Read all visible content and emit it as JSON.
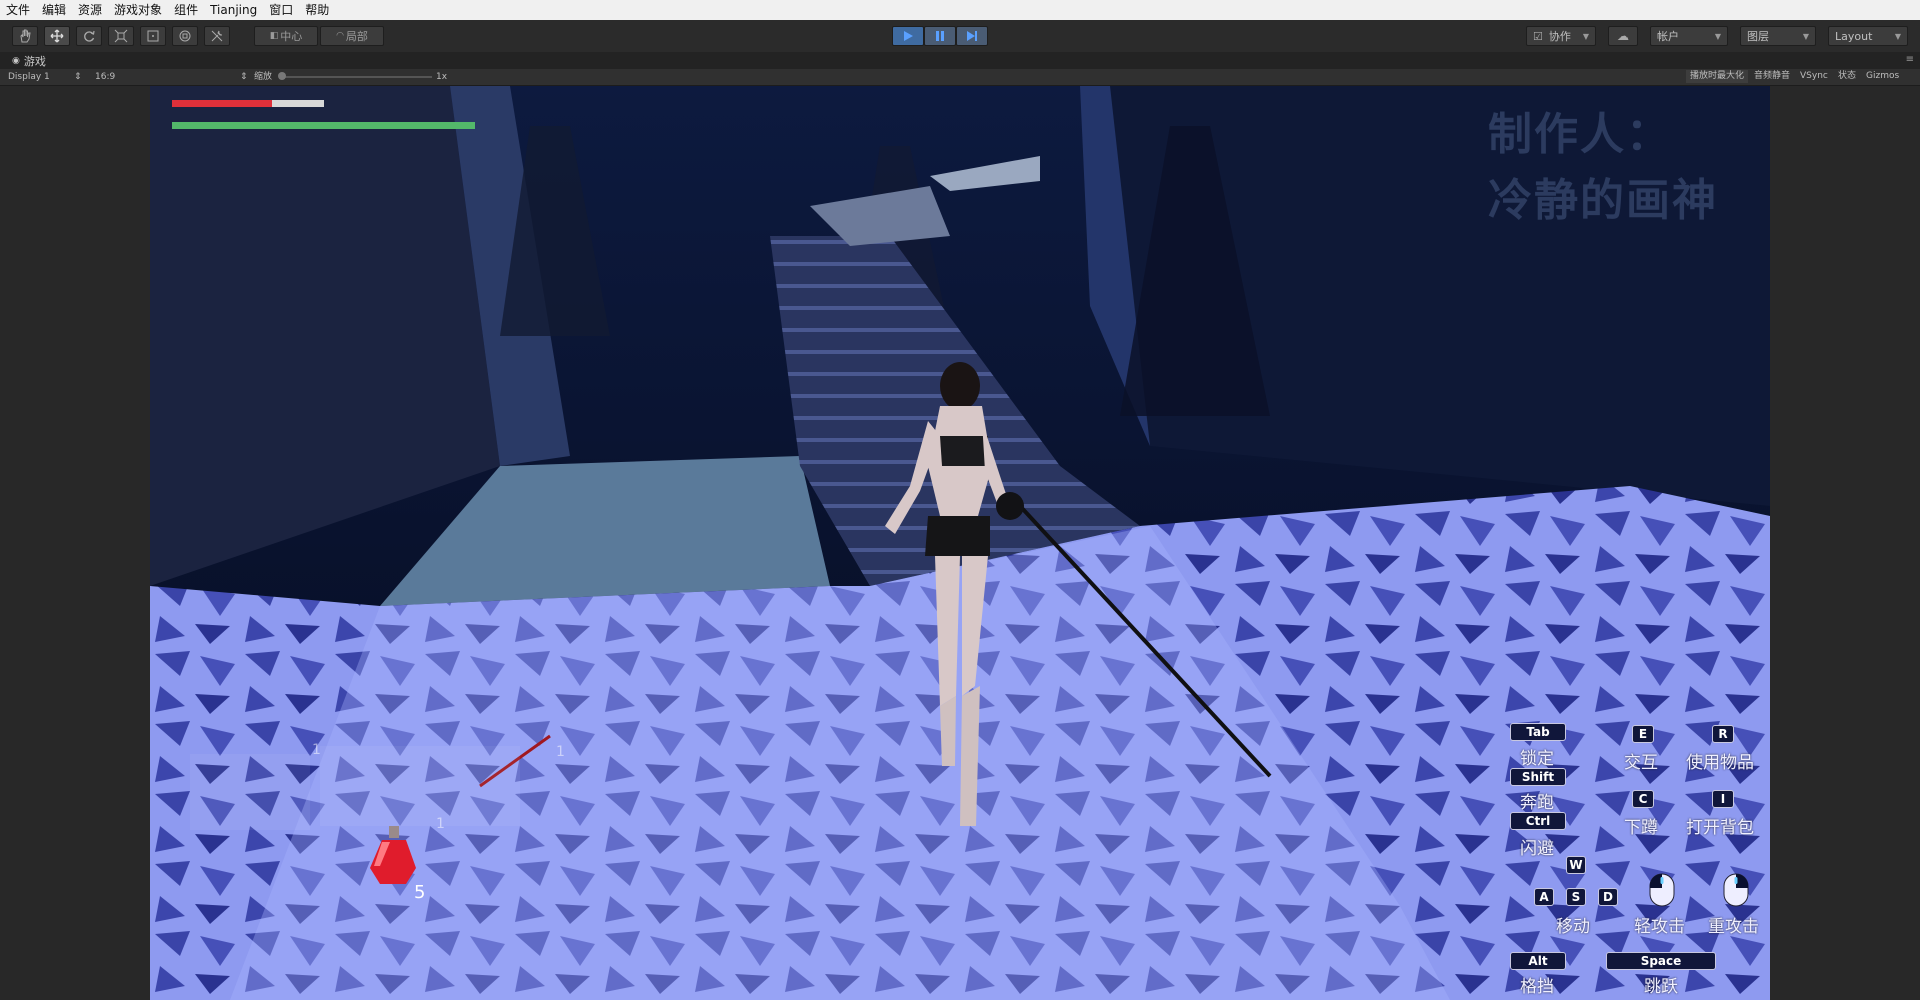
{
  "menu": [
    "文件",
    "编辑",
    "资源",
    "游戏对象",
    "组件",
    "Tianjing",
    "窗口",
    "帮助"
  ],
  "toolbar": {
    "pivot_label": "中心",
    "space_label": "局部",
    "collab_label": "协作",
    "account_label": "帐户",
    "layers_label": "图层",
    "layout_label": "Layout"
  },
  "tab": {
    "label": "游戏"
  },
  "gamebar": {
    "display": "Display 1",
    "aspect": "16:9",
    "scale_label": "缩放",
    "scale_value": "1x",
    "maximize": "播放时最大化",
    "mute": "音频静音",
    "vsync": "VSync",
    "stats": "状态",
    "gizmos": "Gizmos"
  },
  "hud": {
    "health": 0.66,
    "stamina": 1.0,
    "credit_line1": "制作人：",
    "credit_line2": "冷静的画神",
    "potion_count": "5",
    "slot_nums": [
      "1",
      "1",
      "1"
    ]
  },
  "controls": {
    "tab_key": "Tab",
    "tab_label": "锁定",
    "shift_key": "Shift",
    "shift_label": "奔跑",
    "ctrl_key": "Ctrl",
    "ctrl_label": "闪避",
    "w_key": "W",
    "a_key": "A",
    "s_key": "S",
    "d_key": "D",
    "move_label": "移动",
    "alt_key": "Alt",
    "alt_label": "格挡",
    "e_key": "E",
    "e_label": "交互",
    "r_key": "R",
    "r_label": "使用物品",
    "c_key": "C",
    "c_label": "下蹲",
    "i_key": "I",
    "i_label": "打开背包",
    "light_label": "轻攻击",
    "heavy_label": "重攻击",
    "space_key": "Space",
    "space_label": "跳跃"
  },
  "colors": {
    "health": "#e0303a",
    "stamina": "#53b86a",
    "play_active": "#3f6ba1"
  }
}
